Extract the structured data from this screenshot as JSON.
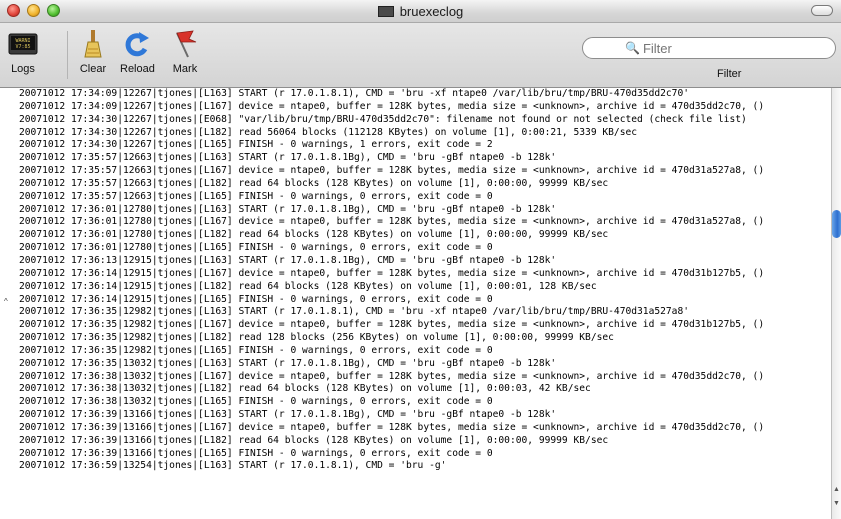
{
  "window": {
    "title": "bruexeclog"
  },
  "toolbar": {
    "logs_label": "Logs",
    "clear_label": "Clear",
    "reload_label": "Reload",
    "mark_label": "Mark",
    "filter_label": "Filter",
    "search_placeholder": "Filter"
  },
  "log_lines": [
    "20071012 17:34:09|12267|tjones|[L163] START (r 17.0.1.8.1), CMD = 'bru -xf ntape0 /var/lib/bru/tmp/BRU-470d35dd2c70'",
    "20071012 17:34:09|12267|tjones|[L167] device = ntape0, buffer = 128K bytes, media size = <unknown>, archive id = 470d35dd2c70, ()",
    "20071012 17:34:30|12267|tjones|[E068] \"var/lib/bru/tmp/BRU-470d35dd2c70\": filename not found or not selected (check file list)",
    "20071012 17:34:30|12267|tjones|[L182] read 56064 blocks (112128 KBytes) on volume [1], 0:00:21, 5339 KB/sec",
    "20071012 17:34:30|12267|tjones|[L165] FINISH - 0 warnings, 1 errors, exit code = 2",
    "20071012 17:35:57|12663|tjones|[L163] START (r 17.0.1.8.1Bg), CMD = 'bru -gBf ntape0 -b 128k'",
    "20071012 17:35:57|12663|tjones|[L167] device = ntape0, buffer = 128K bytes, media size = <unknown>, archive id = 470d31a527a8, ()",
    "20071012 17:35:57|12663|tjones|[L182] read 64 blocks (128 KBytes) on volume [1], 0:00:00, 99999 KB/sec",
    "20071012 17:35:57|12663|tjones|[L165] FINISH - 0 warnings, 0 errors, exit code = 0",
    "20071012 17:36:01|12780|tjones|[L163] START (r 17.0.1.8.1Bg), CMD = 'bru -gBf ntape0 -b 128k'",
    "20071012 17:36:01|12780|tjones|[L167] device = ntape0, buffer = 128K bytes, media size = <unknown>, archive id = 470d31a527a8, ()",
    "20071012 17:36:01|12780|tjones|[L182] read 64 blocks (128 KBytes) on volume [1], 0:00:00, 99999 KB/sec",
    "20071012 17:36:01|12780|tjones|[L165] FINISH - 0 warnings, 0 errors, exit code = 0",
    "20071012 17:36:13|12915|tjones|[L163] START (r 17.0.1.8.1Bg), CMD = 'bru -gBf ntape0 -b 128k'",
    "20071012 17:36:14|12915|tjones|[L167] device = ntape0, buffer = 128K bytes, media size = <unknown>, archive id = 470d31b127b5, ()",
    "20071012 17:36:14|12915|tjones|[L182] read 64 blocks (128 KBytes) on volume [1], 0:00:01, 128 KB/sec",
    "20071012 17:36:14|12915|tjones|[L165] FINISH - 0 warnings, 0 errors, exit code = 0",
    "20071012 17:36:35|12982|tjones|[L163] START (r 17.0.1.8.1), CMD = 'bru -xf ntape0 /var/lib/bru/tmp/BRU-470d31a527a8'",
    "20071012 17:36:35|12982|tjones|[L167] device = ntape0, buffer = 128K bytes, media size = <unknown>, archive id = 470d31b127b5, ()",
    "20071012 17:36:35|12982|tjones|[L182] read 128 blocks (256 KBytes) on volume [1], 0:00:00, 99999 KB/sec",
    "20071012 17:36:35|12982|tjones|[L165] FINISH - 0 warnings, 0 errors, exit code = 0",
    "20071012 17:36:35|13032|tjones|[L163] START (r 17.0.1.8.1Bg), CMD = 'bru -gBf ntape0 -b 128k'",
    "20071012 17:36:38|13032|tjones|[L167] device = ntape0, buffer = 128K bytes, media size = <unknown>, archive id = 470d35dd2c70, ()",
    "20071012 17:36:38|13032|tjones|[L182] read 64 blocks (128 KBytes) on volume [1], 0:00:03, 42 KB/sec",
    "20071012 17:36:38|13032|tjones|[L165] FINISH - 0 warnings, 0 errors, exit code = 0",
    "20071012 17:36:39|13166|tjones|[L163] START (r 17.0.1.8.1Bg), CMD = 'bru -gBf ntape0 -b 128k'",
    "20071012 17:36:39|13166|tjones|[L167] device = ntape0, buffer = 128K bytes, media size = <unknown>, archive id = 470d35dd2c70, ()",
    "20071012 17:36:39|13166|tjones|[L182] read 64 blocks (128 KBytes) on volume [1], 0:00:00, 99999 KB/sec",
    "20071012 17:36:39|13166|tjones|[L165] FINISH - 0 warnings, 0 errors, exit code = 0",
    "20071012 17:36:59|13254|tjones|[L163] START (r 17.0.1.8.1), CMD = 'bru -g'"
  ]
}
